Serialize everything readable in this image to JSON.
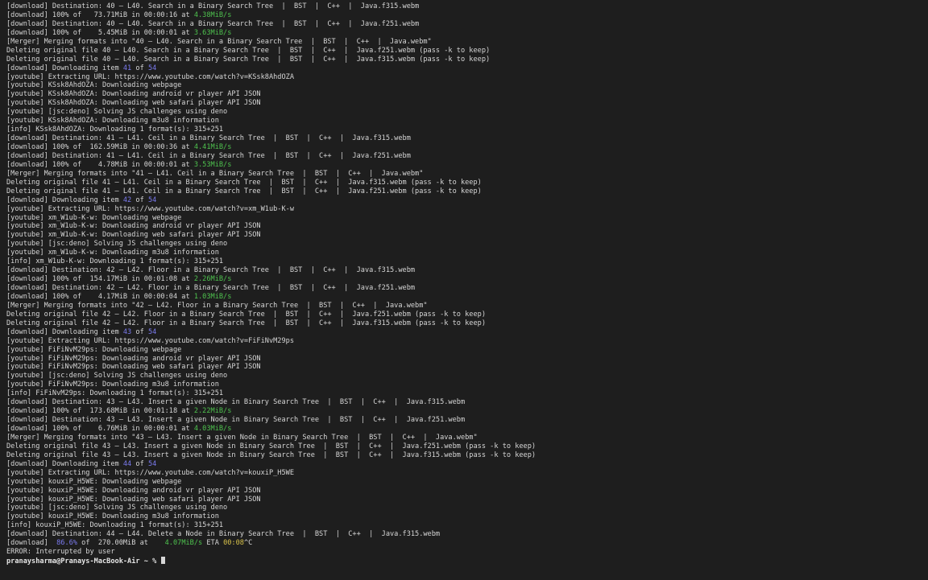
{
  "terminal": {
    "colors": {
      "background": "#1e1e1e",
      "text": "#d6d6d6",
      "speed": "#4ec24e",
      "count": "#7b7bf0",
      "eta": "#d8c24a"
    },
    "lines": [
      [
        {
          "t": "[download] Destination: 40 – L40. Search in a Binary Search Tree  |  BST  |  C++  |  Java.f315.webm"
        }
      ],
      [
        {
          "t": "[download] 100% of   73.71MiB in 00:00:16 at "
        },
        {
          "t": "4.38MiB/s",
          "c": "green"
        }
      ],
      [
        {
          "t": "[download] Destination: 40 – L40. Search in a Binary Search Tree  |  BST  |  C++  |  Java.f251.webm"
        }
      ],
      [
        {
          "t": "[download] 100% of    5.45MiB in 00:00:01 at "
        },
        {
          "t": "3.63MiB/s",
          "c": "green"
        }
      ],
      [
        {
          "t": "[Merger] Merging formats into \"40 – L40. Search in a Binary Search Tree  |  BST  |  C++  |  Java.webm\""
        }
      ],
      [
        {
          "t": "Deleting original file 40 – L40. Search in a Binary Search Tree  |  BST  |  C++  |  Java.f251.webm (pass -k to keep)"
        }
      ],
      [
        {
          "t": "Deleting original file 40 – L40. Search in a Binary Search Tree  |  BST  |  C++  |  Java.f315.webm (pass -k to keep)"
        }
      ],
      [
        {
          "t": "[download] Downloading item "
        },
        {
          "t": "41",
          "c": "blue"
        },
        {
          "t": " of "
        },
        {
          "t": "54",
          "c": "blue"
        }
      ],
      [
        {
          "t": "[youtube] Extracting URL: https://www.youtube.com/watch?v=KSsk8AhdOZA"
        }
      ],
      [
        {
          "t": "[youtube] KSsk8AhdOZA: Downloading webpage"
        }
      ],
      [
        {
          "t": "[youtube] KSsk8AhdOZA: Downloading android vr player API JSON"
        }
      ],
      [
        {
          "t": "[youtube] KSsk8AhdOZA: Downloading web safari player API JSON"
        }
      ],
      [
        {
          "t": "[youtube] [jsc:deno] Solving JS challenges using deno"
        }
      ],
      [
        {
          "t": "[youtube] KSsk8AhdOZA: Downloading m3u8 information"
        }
      ],
      [
        {
          "t": "[info] KSsk8AhdOZA: Downloading 1 format(s): 315+251"
        }
      ],
      [
        {
          "t": "[download] Destination: 41 – L41. Ceil in a Binary Search Tree  |  BST  |  C++  |  Java.f315.webm"
        }
      ],
      [
        {
          "t": "[download] 100% of  162.59MiB in 00:00:36 at "
        },
        {
          "t": "4.41MiB/s",
          "c": "green"
        }
      ],
      [
        {
          "t": "[download] Destination: 41 – L41. Ceil in a Binary Search Tree  |  BST  |  C++  |  Java.f251.webm"
        }
      ],
      [
        {
          "t": "[download] 100% of    4.78MiB in 00:00:01 at "
        },
        {
          "t": "3.53MiB/s",
          "c": "green"
        }
      ],
      [
        {
          "t": "[Merger] Merging formats into \"41 – L41. Ceil in a Binary Search Tree  |  BST  |  C++  |  Java.webm\""
        }
      ],
      [
        {
          "t": "Deleting original file 41 – L41. Ceil in a Binary Search Tree  |  BST  |  C++  |  Java.f315.webm (pass -k to keep)"
        }
      ],
      [
        {
          "t": "Deleting original file 41 – L41. Ceil in a Binary Search Tree  |  BST  |  C++  |  Java.f251.webm (pass -k to keep)"
        }
      ],
      [
        {
          "t": "[download] Downloading item "
        },
        {
          "t": "42",
          "c": "blue"
        },
        {
          "t": " of "
        },
        {
          "t": "54",
          "c": "blue"
        }
      ],
      [
        {
          "t": "[youtube] Extracting URL: https://www.youtube.com/watch?v=xm_W1ub-K-w"
        }
      ],
      [
        {
          "t": "[youtube] xm_W1ub-K-w: Downloading webpage"
        }
      ],
      [
        {
          "t": "[youtube] xm_W1ub-K-w: Downloading android vr player API JSON"
        }
      ],
      [
        {
          "t": "[youtube] xm_W1ub-K-w: Downloading web safari player API JSON"
        }
      ],
      [
        {
          "t": "[youtube] [jsc:deno] Solving JS challenges using deno"
        }
      ],
      [
        {
          "t": "[youtube] xm_W1ub-K-w: Downloading m3u8 information"
        }
      ],
      [
        {
          "t": "[info] xm_W1ub-K-w: Downloading 1 format(s): 315+251"
        }
      ],
      [
        {
          "t": "[download] Destination: 42 – L42. Floor in a Binary Search Tree  |  BST  |  C++  |  Java.f315.webm"
        }
      ],
      [
        {
          "t": "[download] 100% of  154.17MiB in 00:01:08 at "
        },
        {
          "t": "2.26MiB/s",
          "c": "green"
        }
      ],
      [
        {
          "t": "[download] Destination: 42 – L42. Floor in a Binary Search Tree  |  BST  |  C++  |  Java.f251.webm"
        }
      ],
      [
        {
          "t": "[download] 100% of    4.17MiB in 00:00:04 at "
        },
        {
          "t": "1.03MiB/s",
          "c": "green"
        }
      ],
      [
        {
          "t": "[Merger] Merging formats into \"42 – L42. Floor in a Binary Search Tree  |  BST  |  C++  |  Java.webm\""
        }
      ],
      [
        {
          "t": "Deleting original file 42 – L42. Floor in a Binary Search Tree  |  BST  |  C++  |  Java.f251.webm (pass -k to keep)"
        }
      ],
      [
        {
          "t": "Deleting original file 42 – L42. Floor in a Binary Search Tree  |  BST  |  C++  |  Java.f315.webm (pass -k to keep)"
        }
      ],
      [
        {
          "t": "[download] Downloading item "
        },
        {
          "t": "43",
          "c": "blue"
        },
        {
          "t": " of "
        },
        {
          "t": "54",
          "c": "blue"
        }
      ],
      [
        {
          "t": "[youtube] Extracting URL: https://www.youtube.com/watch?v=FiFiNvM29ps"
        }
      ],
      [
        {
          "t": "[youtube] FiFiNvM29ps: Downloading webpage"
        }
      ],
      [
        {
          "t": "[youtube] FiFiNvM29ps: Downloading android vr player API JSON"
        }
      ],
      [
        {
          "t": "[youtube] FiFiNvM29ps: Downloading web safari player API JSON"
        }
      ],
      [
        {
          "t": "[youtube] [jsc:deno] Solving JS challenges using deno"
        }
      ],
      [
        {
          "t": "[youtube] FiFiNvM29ps: Downloading m3u8 information"
        }
      ],
      [
        {
          "t": "[info] FiFiNvM29ps: Downloading 1 format(s): 315+251"
        }
      ],
      [
        {
          "t": "[download] Destination: 43 – L43. Insert a given Node in Binary Search Tree  |  BST  |  C++  |  Java.f315.webm"
        }
      ],
      [
        {
          "t": "[download] 100% of  173.68MiB in 00:01:18 at "
        },
        {
          "t": "2.22MiB/s",
          "c": "green"
        }
      ],
      [
        {
          "t": "[download] Destination: 43 – L43. Insert a given Node in Binary Search Tree  |  BST  |  C++  |  Java.f251.webm"
        }
      ],
      [
        {
          "t": "[download] 100% of    6.76MiB in 00:00:01 at "
        },
        {
          "t": "4.03MiB/s",
          "c": "green"
        }
      ],
      [
        {
          "t": "[Merger] Merging formats into \"43 – L43. Insert a given Node in Binary Search Tree  |  BST  |  C++  |  Java.webm\""
        }
      ],
      [
        {
          "t": "Deleting original file 43 – L43. Insert a given Node in Binary Search Tree  |  BST  |  C++  |  Java.f251.webm (pass -k to keep)"
        }
      ],
      [
        {
          "t": "Deleting original file 43 – L43. Insert a given Node in Binary Search Tree  |  BST  |  C++  |  Java.f315.webm (pass -k to keep)"
        }
      ],
      [
        {
          "t": "[download] Downloading item "
        },
        {
          "t": "44",
          "c": "blue"
        },
        {
          "t": " of "
        },
        {
          "t": "54",
          "c": "blue"
        }
      ],
      [
        {
          "t": "[youtube] Extracting URL: https://www.youtube.com/watch?v=kouxiP_H5WE"
        }
      ],
      [
        {
          "t": "[youtube] kouxiP_H5WE: Downloading webpage"
        }
      ],
      [
        {
          "t": "[youtube] kouxiP_H5WE: Downloading android vr player API JSON"
        }
      ],
      [
        {
          "t": "[youtube] kouxiP_H5WE: Downloading web safari player API JSON"
        }
      ],
      [
        {
          "t": "[youtube] [jsc:deno] Solving JS challenges using deno"
        }
      ],
      [
        {
          "t": "[youtube] kouxiP_H5WE: Downloading m3u8 information"
        }
      ],
      [
        {
          "t": "[info] kouxiP_H5WE: Downloading 1 format(s): 315+251"
        }
      ],
      [
        {
          "t": "[download] Destination: 44 – L44. Delete a Node in Binary Search Tree  |  BST  |  C++  |  Java.f315.webm"
        }
      ],
      [
        {
          "t": "[download]  "
        },
        {
          "t": "86.6%",
          "c": "blue"
        },
        {
          "t": " of  270.00MiB at    "
        },
        {
          "t": "4.07MiB/s",
          "c": "green"
        },
        {
          "t": " ETA "
        },
        {
          "t": "00:08",
          "c": "yellow"
        },
        {
          "t": "^C"
        }
      ],
      [
        {
          "t": "ERROR: Interrupted by user"
        }
      ],
      [
        {
          "t": "pranaysharma@Pranays-MacBook-Air ~ % ",
          "c": "bold"
        }
      ]
    ]
  }
}
